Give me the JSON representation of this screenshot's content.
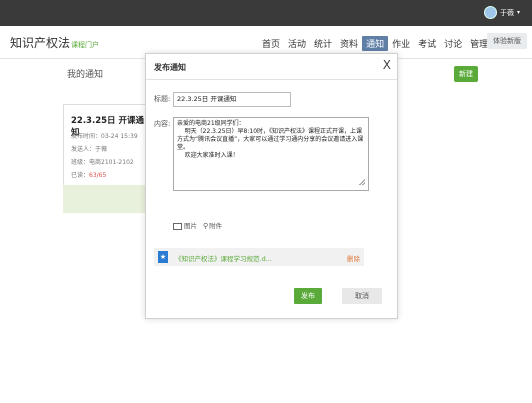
{
  "topbar": {
    "username": "于薇"
  },
  "header": {
    "brand": "知识产权法",
    "brand_sub": "课程门户",
    "nav": [
      "首页",
      "活动",
      "统计",
      "资料",
      "通知",
      "作业",
      "考试",
      "讨论",
      "管理"
    ],
    "active_nav": "通知",
    "trial_button": "体验新版"
  },
  "page": {
    "title": "我的通知",
    "new_button": "新建",
    "card": {
      "title": "22.3.25日 开课通知",
      "publish_time": "发布时间：03-24 15:39",
      "sender": "发送人：于薇",
      "class": "班级：电商2101-2102",
      "read_label": "已读：",
      "read_count": "63/65"
    }
  },
  "modal": {
    "title": "发布通知",
    "close": "X",
    "title_label": "标题:",
    "title_value": "22.3.25日 开课通知",
    "content_label": "内容:",
    "content_value": "亲爱的电商21级同学们：\n    明天（22.3.25日）早8:10时，《知识产权法》课程正式开课，上课方式为“腾讯会议直播”，大家可以通过学习通内分享的会议邀请进入课堂。\n    欢迎大家准时入课！",
    "image_label": "图片",
    "attach_label": "附件",
    "file_name": "《知识产权法》课程学习规范.d...",
    "file_delete": "删除",
    "publish_button": "发布",
    "cancel_button": "取消"
  },
  "colors": {
    "green": "#5aaa3a",
    "nav_active": "#5f7fa7",
    "topbar": "#3a3a3a"
  }
}
